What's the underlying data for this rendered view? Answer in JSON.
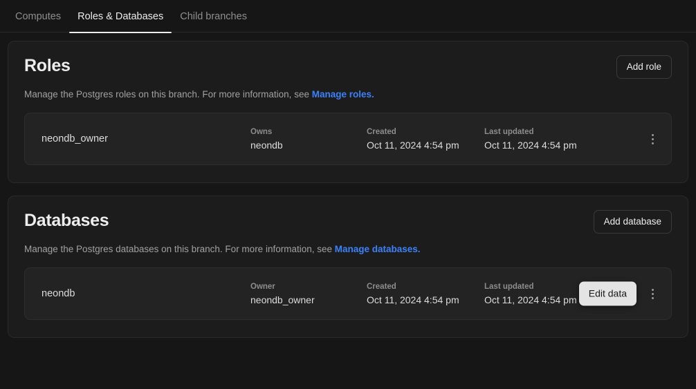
{
  "tabs": [
    {
      "label": "Computes",
      "active": false
    },
    {
      "label": "Roles & Databases",
      "active": true
    },
    {
      "label": "Child branches",
      "active": false
    }
  ],
  "roles_section": {
    "title": "Roles",
    "add_button": "Add role",
    "description_prefix": "Manage the Postgres roles on this branch. For more information, see ",
    "link_text": "Manage roles.",
    "columns": {
      "owns": "Owns",
      "created": "Created",
      "updated": "Last updated"
    },
    "rows": [
      {
        "name": "neondb_owner",
        "owns": "neondb",
        "created": "Oct 11, 2024 4:54 pm",
        "updated": "Oct 11, 2024 4:54 pm"
      }
    ]
  },
  "databases_section": {
    "title": "Databases",
    "add_button": "Add database",
    "description_prefix": "Manage the Postgres databases on this branch. For more information, see ",
    "link_text": "Manage databases.",
    "columns": {
      "owner": "Owner",
      "created": "Created",
      "updated": "Last updated"
    },
    "rows": [
      {
        "name": "neondb",
        "owner": "neondb_owner",
        "created": "Oct 11, 2024 4:54 pm",
        "updated": "Oct 11, 2024 4:54 pm"
      }
    ],
    "tooltip": "Edit data"
  },
  "colors": {
    "page_background": "#161616",
    "card_background": "#1c1c1c",
    "row_background": "#232323",
    "link": "#3b82f6",
    "text_primary": "#ededed",
    "text_muted": "#8f8f8f",
    "tooltip_background": "#e4e4e4"
  }
}
